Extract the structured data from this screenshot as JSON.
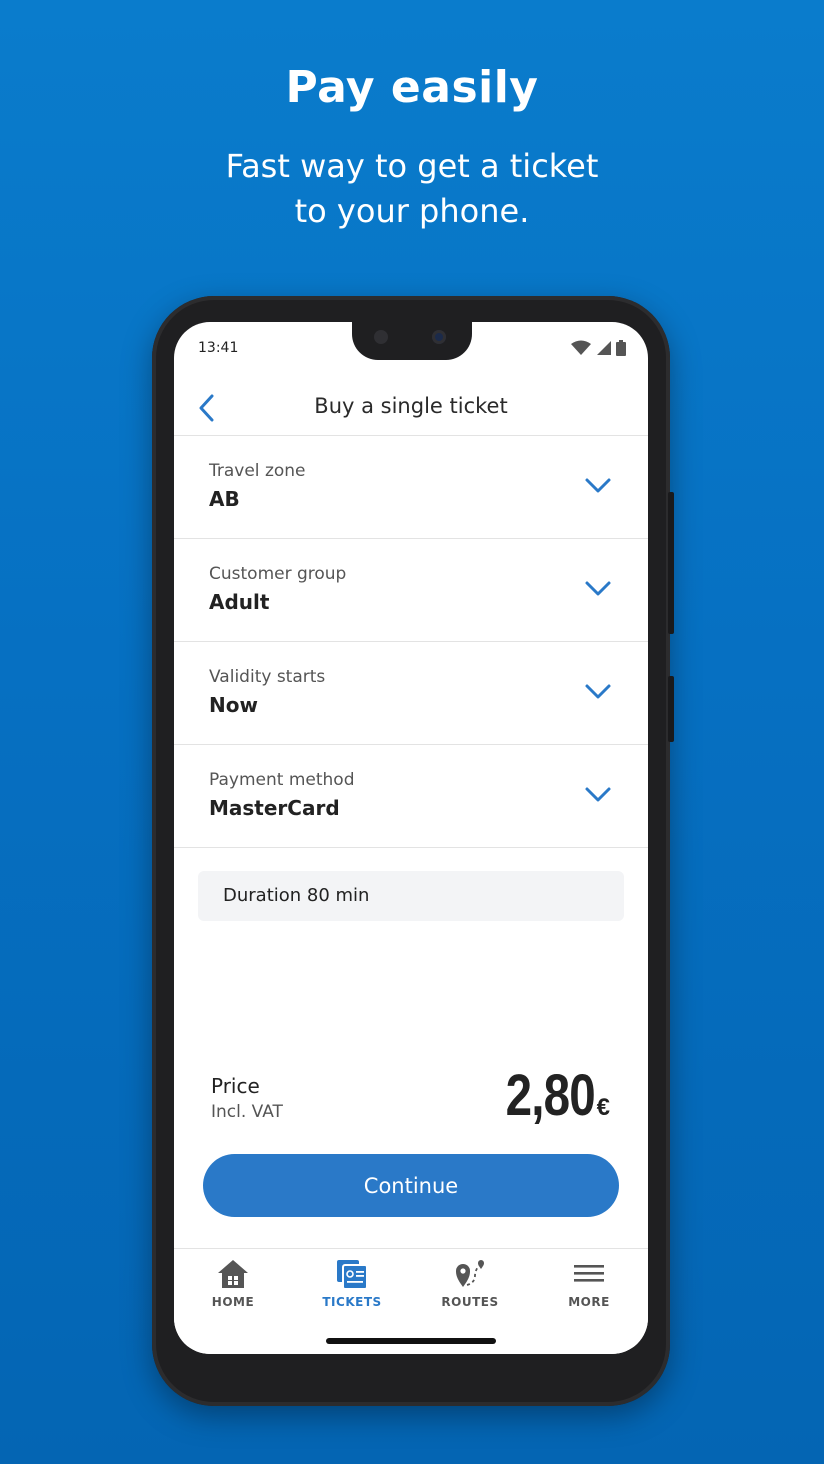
{
  "promo": {
    "headline": "Pay easily",
    "subline": "Fast way to get a ticket\nto your phone."
  },
  "status_bar": {
    "time": "13:41",
    "icons": [
      "wifi-icon",
      "cell-signal-icon",
      "battery-icon"
    ]
  },
  "header": {
    "back_icon": "chevron-left-icon",
    "title": "Buy a single ticket"
  },
  "options": [
    {
      "label": "Travel zone",
      "value": "AB"
    },
    {
      "label": "Customer group",
      "value": "Adult"
    },
    {
      "label": "Validity starts",
      "value": "Now"
    },
    {
      "label": "Payment method",
      "value": "MasterCard"
    }
  ],
  "duration": {
    "text": "Duration 80 min"
  },
  "price": {
    "label": "Price",
    "sublabel": "Incl. VAT",
    "amount": "2,80",
    "currency": "€"
  },
  "continue_label": "Continue",
  "nav": [
    {
      "label": "HOME",
      "icon": "home-icon",
      "active": false
    },
    {
      "label": "TICKETS",
      "icon": "tickets-icon",
      "active": true
    },
    {
      "label": "ROUTES",
      "icon": "routes-icon",
      "active": false
    },
    {
      "label": "MORE",
      "icon": "menu-icon",
      "active": false
    }
  ],
  "colors": {
    "background": "#0670c2",
    "accent": "#2a79c8",
    "text": "#222222"
  }
}
